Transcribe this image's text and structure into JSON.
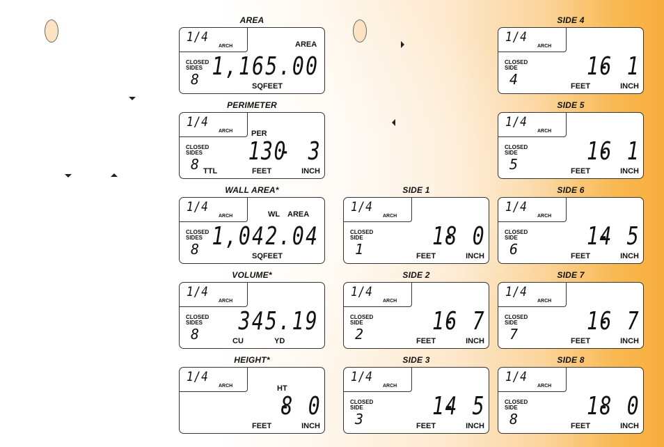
{
  "background": {
    "gradient_from": "#ffffff",
    "gradient_to": "#f7ad3e"
  },
  "markers": {
    "ovals": [
      {
        "name": "oval-marker-left",
        "color": "#fde3c3"
      },
      {
        "name": "oval-marker-middle",
        "color": "#fde3c3"
      }
    ],
    "arrows": [
      "down",
      "down",
      "up",
      "right",
      "left"
    ]
  },
  "lcd_common": {
    "fraction": "1/4",
    "arch": "ARCH",
    "closed": "CLOSED",
    "sides": "SIDES",
    "side": "SIDE",
    "feet": "FEET",
    "inch": "INCH"
  },
  "summary_panels": [
    {
      "title": "AREA",
      "top_label": "AREA",
      "value": "1,165.00",
      "units": "SQFEET",
      "sides_count": "8"
    },
    {
      "title": "PERIMETER",
      "top_label": "PER",
      "feet": "130",
      "inch": "3",
      "ttl": "TTL",
      "sides_count": "8"
    },
    {
      "title": "WALL AREA*",
      "top_label_1": "WL",
      "top_label_2": "AREA",
      "value": "1,042.04",
      "units": "SQFEET",
      "sides_count": "8"
    },
    {
      "title": "VOLUME*",
      "value": "345.19",
      "unit_1": "CU",
      "unit_2": "YD",
      "sides_count": "8"
    },
    {
      "title": "HEIGHT*",
      "top_label": "HT",
      "feet": "8",
      "inch": "0"
    }
  ],
  "sides": [
    {
      "title": "SIDE 1",
      "number": "1",
      "feet": "18",
      "inch": "0"
    },
    {
      "title": "SIDE 2",
      "number": "2",
      "feet": "16",
      "inch": "7"
    },
    {
      "title": "SIDE 3",
      "number": "3",
      "feet": "14",
      "inch": "5"
    },
    {
      "title": "SIDE 4",
      "number": "4",
      "feet": "16",
      "inch": "1"
    },
    {
      "title": "SIDE 5",
      "number": "5",
      "feet": "16",
      "inch": "1"
    },
    {
      "title": "SIDE 6",
      "number": "6",
      "feet": "14",
      "inch": "5"
    },
    {
      "title": "SIDE 7",
      "number": "7",
      "feet": "16",
      "inch": "7"
    },
    {
      "title": "SIDE 8",
      "number": "8",
      "feet": "18",
      "inch": "0"
    }
  ]
}
